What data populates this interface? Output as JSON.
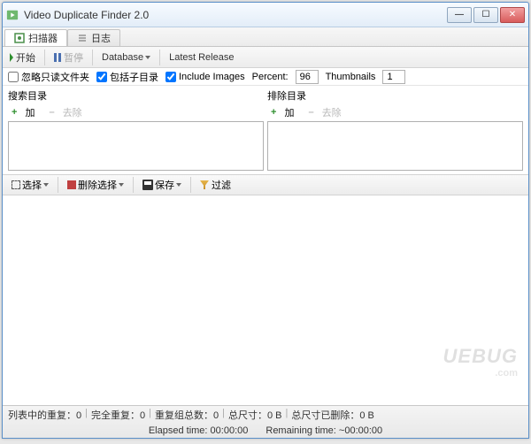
{
  "window": {
    "title": "Video Duplicate Finder 2.0"
  },
  "tabs": {
    "scanner": "扫描器",
    "log": "日志"
  },
  "toolbar1": {
    "start": "开始",
    "pause": "暂停",
    "database": "Database",
    "latest": "Latest Release"
  },
  "options": {
    "ignoreReadonly": "忽略只读文件夹",
    "ignoreReadonlyChecked": false,
    "includeSub": "包括子目录",
    "includeSubChecked": true,
    "includeImages": "Include Images",
    "includeImagesChecked": true,
    "percentLabel": "Percent:",
    "percentValue": "96",
    "thumbLabel": "Thumbnails",
    "thumbValue": "1"
  },
  "dirs": {
    "search": {
      "title": "搜索目录",
      "add": "加",
      "remove": "去除"
    },
    "exclude": {
      "title": "排除目录",
      "add": "加",
      "remove": "去除"
    }
  },
  "toolbar2": {
    "select": "选择",
    "delSelect": "删除选择",
    "save": "保存",
    "filter": "过滤"
  },
  "status": {
    "dupInList": "列表中的重复：",
    "dupInListV": "0",
    "fullDup": "完全重复：",
    "fullDupV": "0",
    "groupCount": "重复组总数：",
    "groupCountV": "0",
    "totalSize": "总尺寸：",
    "totalSizeV": "0 B",
    "sizeDeleted": "总尺寸已删除：",
    "sizeDeletedV": "0 B",
    "elapsedLabel": "Elapsed time:",
    "elapsedV": "00:00:00",
    "remainLabel": "Remaining time:",
    "remainV": "~00:00:00"
  },
  "watermark": {
    "main": "UEBUG",
    "sub": ".com"
  }
}
